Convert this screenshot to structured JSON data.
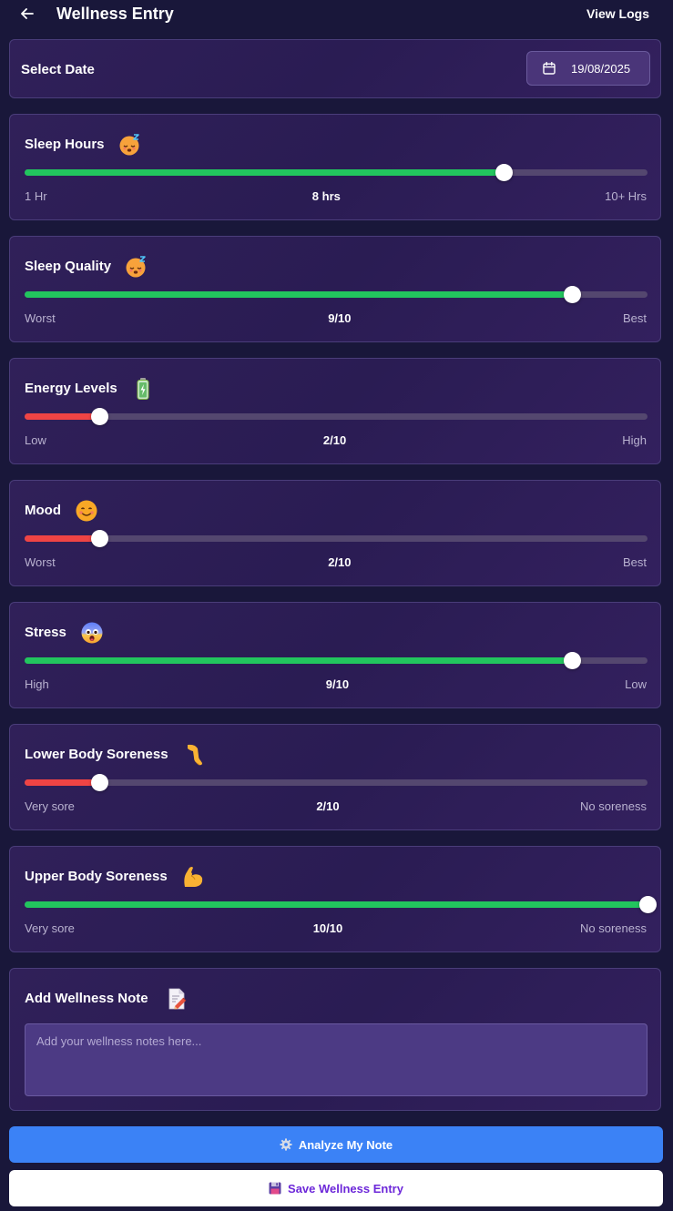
{
  "header": {
    "title": "Wellness Entry",
    "view_logs_label": "View Logs",
    "back_icon": "arrow-left-icon"
  },
  "date_section": {
    "label": "Select Date",
    "value": "19/08/2025",
    "icon": "calendar-icon"
  },
  "metrics": [
    {
      "id": "sleep-hours",
      "title": "Sleep Hours",
      "emoji": "sleeping-face-emoji",
      "min_label": "1 Hr",
      "max_label": "10+ Hrs",
      "value_label": "8 hrs",
      "fraction": 0.77,
      "fill_color": "#22c55e"
    },
    {
      "id": "sleep-quality",
      "title": "Sleep Quality",
      "emoji": "sleeping-face-emoji",
      "min_label": "Worst",
      "max_label": "Best",
      "value_label": "9/10",
      "fraction": 0.88,
      "fill_color": "#22c55e"
    },
    {
      "id": "energy-levels",
      "title": "Energy Levels",
      "emoji": "battery-emoji",
      "min_label": "Low",
      "max_label": "High",
      "value_label": "2/10",
      "fraction": 0.12,
      "fill_color": "#ef4444"
    },
    {
      "id": "mood",
      "title": "Mood",
      "emoji": "smiling-face-emoji",
      "min_label": "Worst",
      "max_label": "Best",
      "value_label": "2/10",
      "fraction": 0.12,
      "fill_color": "#ef4444"
    },
    {
      "id": "stress",
      "title": "Stress",
      "emoji": "fearful-face-emoji",
      "min_label": "High",
      "max_label": "Low",
      "value_label": "9/10",
      "fraction": 0.88,
      "fill_color": "#22c55e"
    },
    {
      "id": "lower-body-soreness",
      "title": "Lower Body Soreness",
      "emoji": "leg-emoji",
      "min_label": "Very sore",
      "max_label": "No soreness",
      "value_label": "2/10",
      "fraction": 0.12,
      "fill_color": "#ef4444"
    },
    {
      "id": "upper-body-soreness",
      "title": "Upper Body Soreness",
      "emoji": "flexed-biceps-emoji",
      "min_label": "Very sore",
      "max_label": "No soreness",
      "value_label": "10/10",
      "fraction": 1.0,
      "fill_color": "#22c55e"
    }
  ],
  "note": {
    "title": "Add Wellness Note",
    "emoji": "memo-emoji",
    "placeholder": "Add your wellness notes here...",
    "value": ""
  },
  "actions": {
    "analyze_label": "Analyze My Note",
    "analyze_icon": "gear-icon",
    "save_label": "Save Wellness Entry",
    "save_icon": "floppy-disk-icon"
  },
  "colors": {
    "background": "#19173a",
    "card": "#2d1f58",
    "green": "#22c55e",
    "red": "#ef4444",
    "analyze_button": "#3b82f6",
    "save_text": "#6d28d9"
  }
}
